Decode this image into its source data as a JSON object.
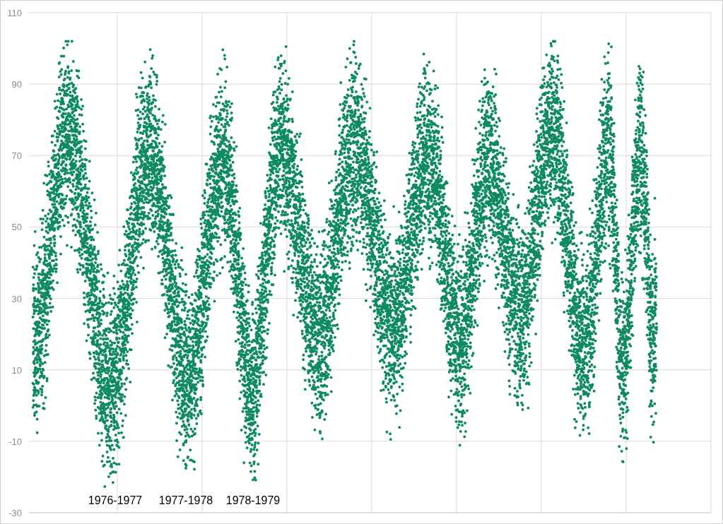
{
  "chart": {
    "y_axis_labels": [
      "110",
      "90",
      "70",
      "50",
      "30",
      "10",
      "-10",
      "-30"
    ],
    "season_labels": [
      "1976-1977",
      "1977-1978",
      "1978-1979"
    ]
  }
}
